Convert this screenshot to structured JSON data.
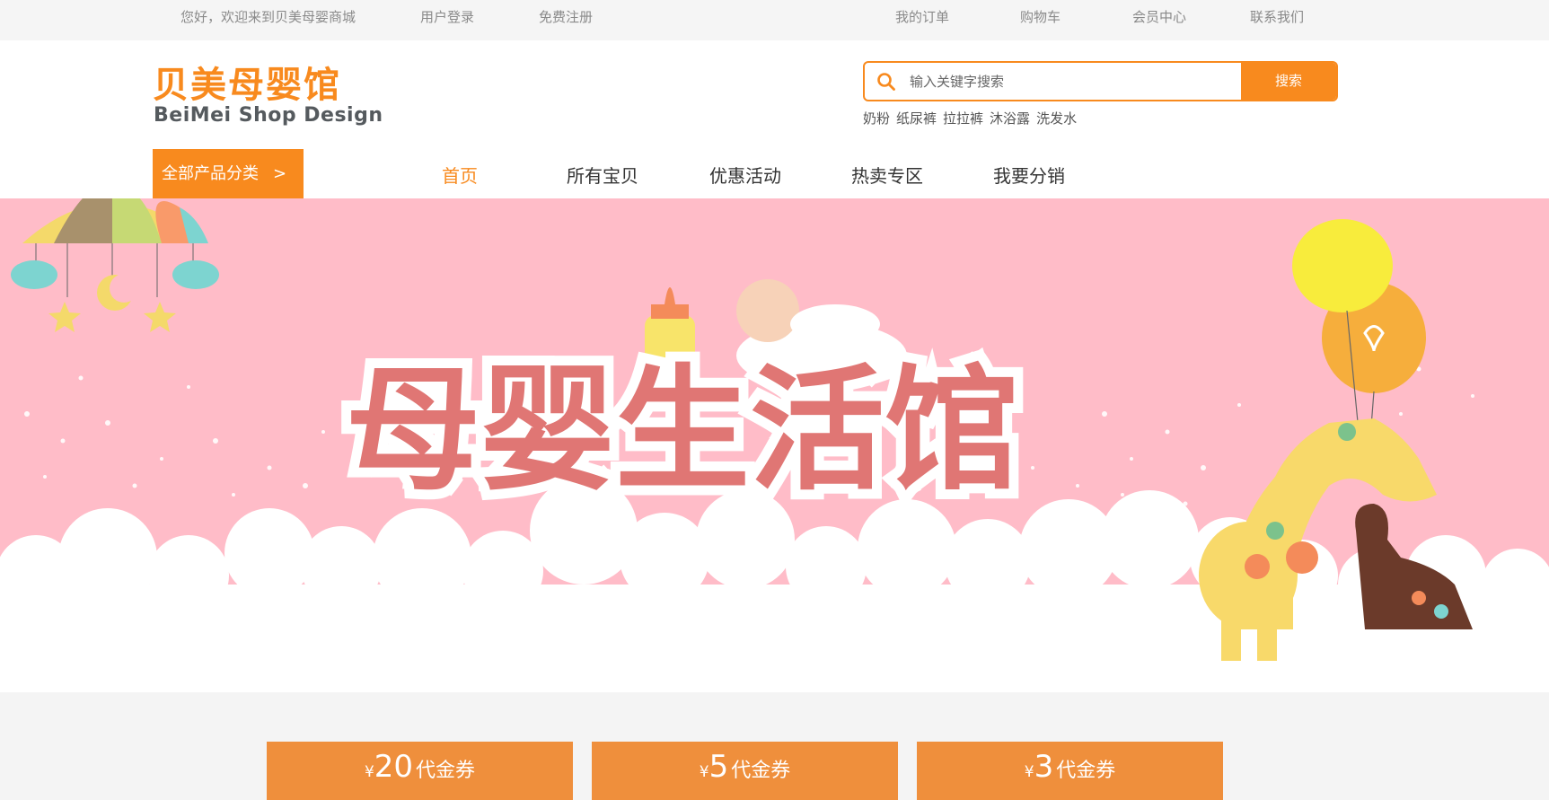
{
  "topbar": {
    "welcome": "您好，欢迎来到贝美母婴商城",
    "login": "用户登录",
    "register": "免费注册",
    "orders": "我的订单",
    "cart": "购物车",
    "member": "会员中心",
    "contact": "联系我们"
  },
  "logo": {
    "cn": "贝美母婴馆",
    "en": "BeiMei  Shop Design"
  },
  "search": {
    "placeholder": "输入关键字搜索",
    "button": "搜索",
    "hotwords": [
      "奶粉",
      "纸尿裤",
      "拉拉裤",
      "沐浴露",
      "洗发水"
    ]
  },
  "nav": {
    "categories": "全部产品分类",
    "categories_arrow": ">",
    "items": [
      "首页",
      "所有宝贝",
      "优惠活动",
      "热卖专区",
      "我要分销"
    ]
  },
  "banner": {
    "title": "母婴生活馆"
  },
  "coupons": [
    {
      "currency": "¥",
      "amount": "20",
      "label": "代金券"
    },
    {
      "currency": "¥",
      "amount": "5",
      "label": "代金券"
    },
    {
      "currency": "¥",
      "amount": "3",
      "label": "代金券"
    }
  ],
  "colors": {
    "accent": "#f88a1e",
    "banner_bg": "#ffbcc8",
    "coupon_bg": "#ef8f3c"
  }
}
